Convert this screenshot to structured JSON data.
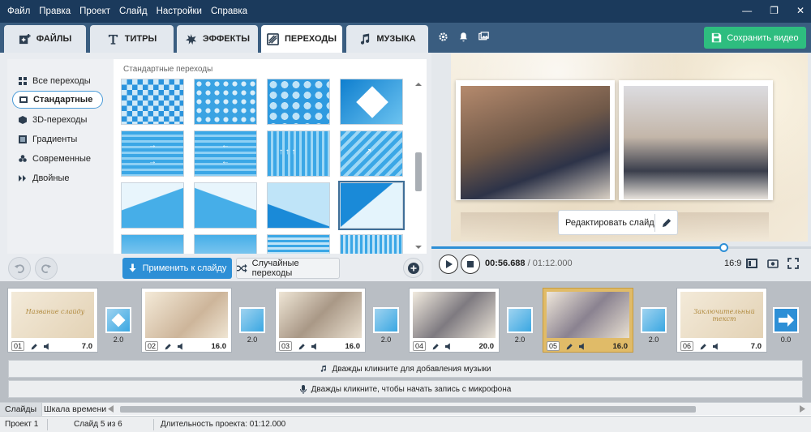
{
  "menu": [
    "Файл",
    "Правка",
    "Проект",
    "Слайд",
    "Настройки",
    "Справка"
  ],
  "tabs": [
    {
      "label": "ФАЙЛЫ",
      "icon": "plus-frame-icon"
    },
    {
      "label": "ТИТРЫ",
      "icon": "text-t-icon"
    },
    {
      "label": "ЭФФЕКТЫ",
      "icon": "star-burst-icon"
    },
    {
      "label": "ПЕРЕХОДЫ",
      "icon": "transition-icon"
    },
    {
      "label": "МУЗЫКА",
      "icon": "music-note-icon"
    }
  ],
  "save_label": "Сохранить видео",
  "categories": [
    {
      "label": "Все переходы"
    },
    {
      "label": "Стандартные"
    },
    {
      "label": "3D-переходы"
    },
    {
      "label": "Градиенты"
    },
    {
      "label": "Современные"
    },
    {
      "label": "Двойные"
    }
  ],
  "grid_title": "Стандартные переходы",
  "apply_label": "Применить к слайду",
  "random_label": "Случайные переходы",
  "edit_slide_label": "Редактировать слайд",
  "time_current": "00:56.688",
  "time_total": "/ 01:12.000",
  "aspect": "16:9",
  "progress": 0.77,
  "slides": [
    {
      "num": "01",
      "dur": "7.0",
      "caption": "Название слайду"
    },
    {
      "num": "02",
      "dur": "16.0",
      "caption": ""
    },
    {
      "num": "03",
      "dur": "16.0",
      "caption": ""
    },
    {
      "num": "04",
      "dur": "20.0",
      "caption": ""
    },
    {
      "num": "05",
      "dur": "16.0",
      "caption": ""
    },
    {
      "num": "06",
      "dur": "7.0",
      "caption": "Заключительный текст"
    }
  ],
  "transitions": [
    "2.0",
    "2.0",
    "2.0",
    "2.0",
    "2.0",
    "0.0"
  ],
  "music_hint": "Дважды кликните для добавления музыки",
  "mic_hint": "Дважды кликните, чтобы начать запись с микрофона",
  "bottom_tabs": [
    "Слайды",
    "Шкала времени"
  ],
  "status": {
    "project": "Проект 1",
    "slide": "Слайд 5 из 6",
    "duration": "Длительность проекта: 01:12.000"
  }
}
